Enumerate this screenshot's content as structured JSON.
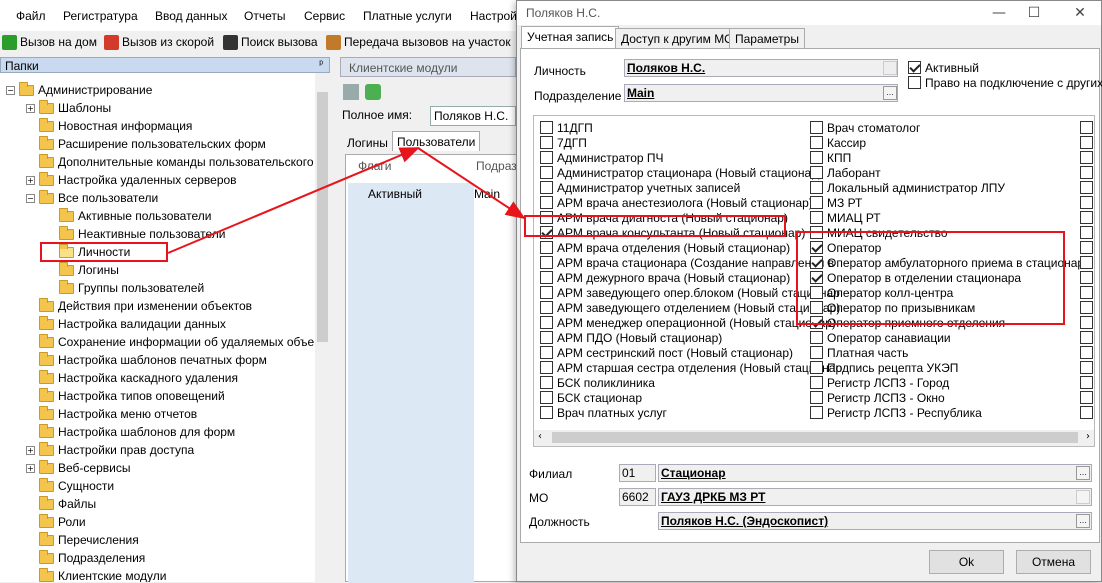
{
  "menubar": [
    "Файл",
    "Регистратура",
    "Ввод данных",
    "Отчеты",
    "Сервис",
    "Платные услуги",
    "Настрой"
  ],
  "toolbar": [
    {
      "label": "Вызов на дом",
      "icon": "green-check-icon",
      "color": "#2a9d2a"
    },
    {
      "label": "Вызов из скорой",
      "icon": "ambulance-icon",
      "color": "#d33a2a"
    },
    {
      "label": "Поиск вызова",
      "icon": "search-call-icon",
      "color": "#333333"
    },
    {
      "label": "Передача вызовов на участок",
      "icon": "transfer-icon",
      "color": "#c07a2a"
    }
  ],
  "folders": {
    "title": "Папки",
    "pin": "ᵖ",
    "tree": [
      {
        "label": "Администрирование",
        "expander": "−"
      },
      {
        "label": "Шаблоны",
        "expander": "+"
      },
      {
        "label": "Новостная информация",
        "expander": ""
      },
      {
        "label": "Расширение пользовательских форм",
        "expander": ""
      },
      {
        "label": "Дополнительные команды пользовательского",
        "expander": ""
      },
      {
        "label": "Настройка удаленных серверов",
        "expander": "+"
      },
      {
        "label": "Все пользователи",
        "expander": "−"
      },
      {
        "label": "Активные пользователи",
        "expander": ""
      },
      {
        "label": "Неактивные пользователи",
        "expander": ""
      },
      {
        "label": "Личности",
        "expander": ""
      },
      {
        "label": "Логины",
        "expander": ""
      },
      {
        "label": "Группы пользователей",
        "expander": ""
      },
      {
        "label": "Действия при изменении объектов",
        "expander": ""
      },
      {
        "label": "Настройка валидации данных",
        "expander": ""
      },
      {
        "label": "Сохранение информации об удаляемых объе",
        "expander": ""
      },
      {
        "label": "Настройка шаблонов печатных форм",
        "expander": ""
      },
      {
        "label": "Настройка каскадного удаления",
        "expander": ""
      },
      {
        "label": "Настройка типов оповещений",
        "expander": ""
      },
      {
        "label": "Настройка меню отчетов",
        "expander": ""
      },
      {
        "label": "Настройка шаблонов для форм",
        "expander": ""
      },
      {
        "label": "Настройки прав доступа",
        "expander": "+"
      },
      {
        "label": "Веб-сервисы",
        "expander": "+"
      },
      {
        "label": "Сущности",
        "expander": ""
      },
      {
        "label": "Файлы",
        "expander": ""
      },
      {
        "label": "Роли",
        "expander": ""
      },
      {
        "label": "Перечисления",
        "expander": ""
      },
      {
        "label": "Подразделения",
        "expander": ""
      },
      {
        "label": "Клиентские модули",
        "expander": ""
      }
    ]
  },
  "middle": {
    "tab": "Клиентские модули",
    "fullname_label": "Полное имя:",
    "fullname_value": "Поляков Н.С.",
    "tabs": [
      "Логины",
      "Пользователи"
    ],
    "grid_headers": [
      "Флаги",
      "Подразд"
    ],
    "grid_row": [
      "Активный",
      "Main"
    ]
  },
  "dialog": {
    "title": "Поляков Н.С.",
    "window_buttons": [
      "—",
      "☐",
      "✕"
    ],
    "tabs": [
      "Учетная запись",
      "Доступ к другим МО",
      "Параметры"
    ],
    "person_label": "Личность",
    "person_value": "Поляков Н.С.",
    "dept_label": "Подразделение",
    "dept_value": "Main",
    "active_label": "Активный",
    "active_checked": true,
    "connect_label": "Право на подключение с других",
    "connect_checked": false,
    "roles_col1": [
      {
        "label": "11ДГП",
        "checked": false
      },
      {
        "label": "7ДГП",
        "checked": false
      },
      {
        "label": "Администратор ПЧ",
        "checked": false
      },
      {
        "label": "Администратор стационара (Новый стационар)",
        "checked": false
      },
      {
        "label": "Администратор учетных записей",
        "checked": false
      },
      {
        "label": "АРМ врача анестезиолога (Новый стационар)",
        "checked": false
      },
      {
        "label": "АРМ врача диагноста (Новый стационар)",
        "checked": false
      },
      {
        "label": "АРМ врача консультанта (Новый стационар)",
        "checked": true
      },
      {
        "label": "АРМ врача отделения (Новый стационар)",
        "checked": false
      },
      {
        "label": "АРМ врача стационара (Создание направления в",
        "checked": false
      },
      {
        "label": "АРМ дежурного врача (Новый стационар)",
        "checked": false
      },
      {
        "label": "АРМ заведующего опер.блоком (Новый стационар",
        "checked": false
      },
      {
        "label": "АРМ заведующего отделением (Новый стационар)",
        "checked": false
      },
      {
        "label": "АРМ менеджер операционной (Новый стационар)",
        "checked": false
      },
      {
        "label": "АРМ ПДО (Новый стационар)",
        "checked": false
      },
      {
        "label": "АРМ сестринский пост (Новый стационар)",
        "checked": false
      },
      {
        "label": "АРМ старшая сестра отделения (Новый стационар",
        "checked": false
      },
      {
        "label": "БСК поликлиника",
        "checked": false
      },
      {
        "label": "БСК стационар",
        "checked": false
      },
      {
        "label": "Врач платных услуг",
        "checked": false
      }
    ],
    "roles_col2": [
      {
        "label": "Врач стоматолог",
        "checked": false
      },
      {
        "label": "Кассир",
        "checked": false
      },
      {
        "label": "КПП",
        "checked": false
      },
      {
        "label": "Лаборант",
        "checked": false
      },
      {
        "label": "Локальный администратор ЛПУ",
        "checked": false
      },
      {
        "label": "МЗ РТ",
        "checked": false
      },
      {
        "label": "МИАЦ РТ",
        "checked": false
      },
      {
        "label": "МИАЦ свидетельство",
        "checked": false
      },
      {
        "label": "Оператор",
        "checked": true
      },
      {
        "label": "Оператор амбулаторного приема в стационаре",
        "checked": true
      },
      {
        "label": "Оператор в отделении стационара",
        "checked": true
      },
      {
        "label": "Оператор колл-центра",
        "checked": false
      },
      {
        "label": "Оператор по призывникам",
        "checked": false
      },
      {
        "label": "Оператор приемного отделения",
        "checked": true
      },
      {
        "label": "Оператор санавиации",
        "checked": false
      },
      {
        "label": "Платная часть",
        "checked": false
      },
      {
        "label": "Подпись рецепта УКЭП",
        "checked": false
      },
      {
        "label": "Регистр ЛСПЗ - Город",
        "checked": false
      },
      {
        "label": "Регистр ЛСПЗ - Окно",
        "checked": false
      },
      {
        "label": "Регистр ЛСПЗ - Республика",
        "checked": false
      }
    ],
    "branch_label": "Филиал",
    "branch_code": "01",
    "branch_value": "Стационар",
    "mo_label": "МО",
    "mo_code": "6602",
    "mo_value": "ГАУЗ ДРКБ МЗ РТ",
    "position_label": "Должность",
    "position_value": "Поляков Н.С. (Эндоскопист)",
    "ok_label": "Ok",
    "cancel_label": "Отмена"
  },
  "annotation_color": "#e8141c"
}
